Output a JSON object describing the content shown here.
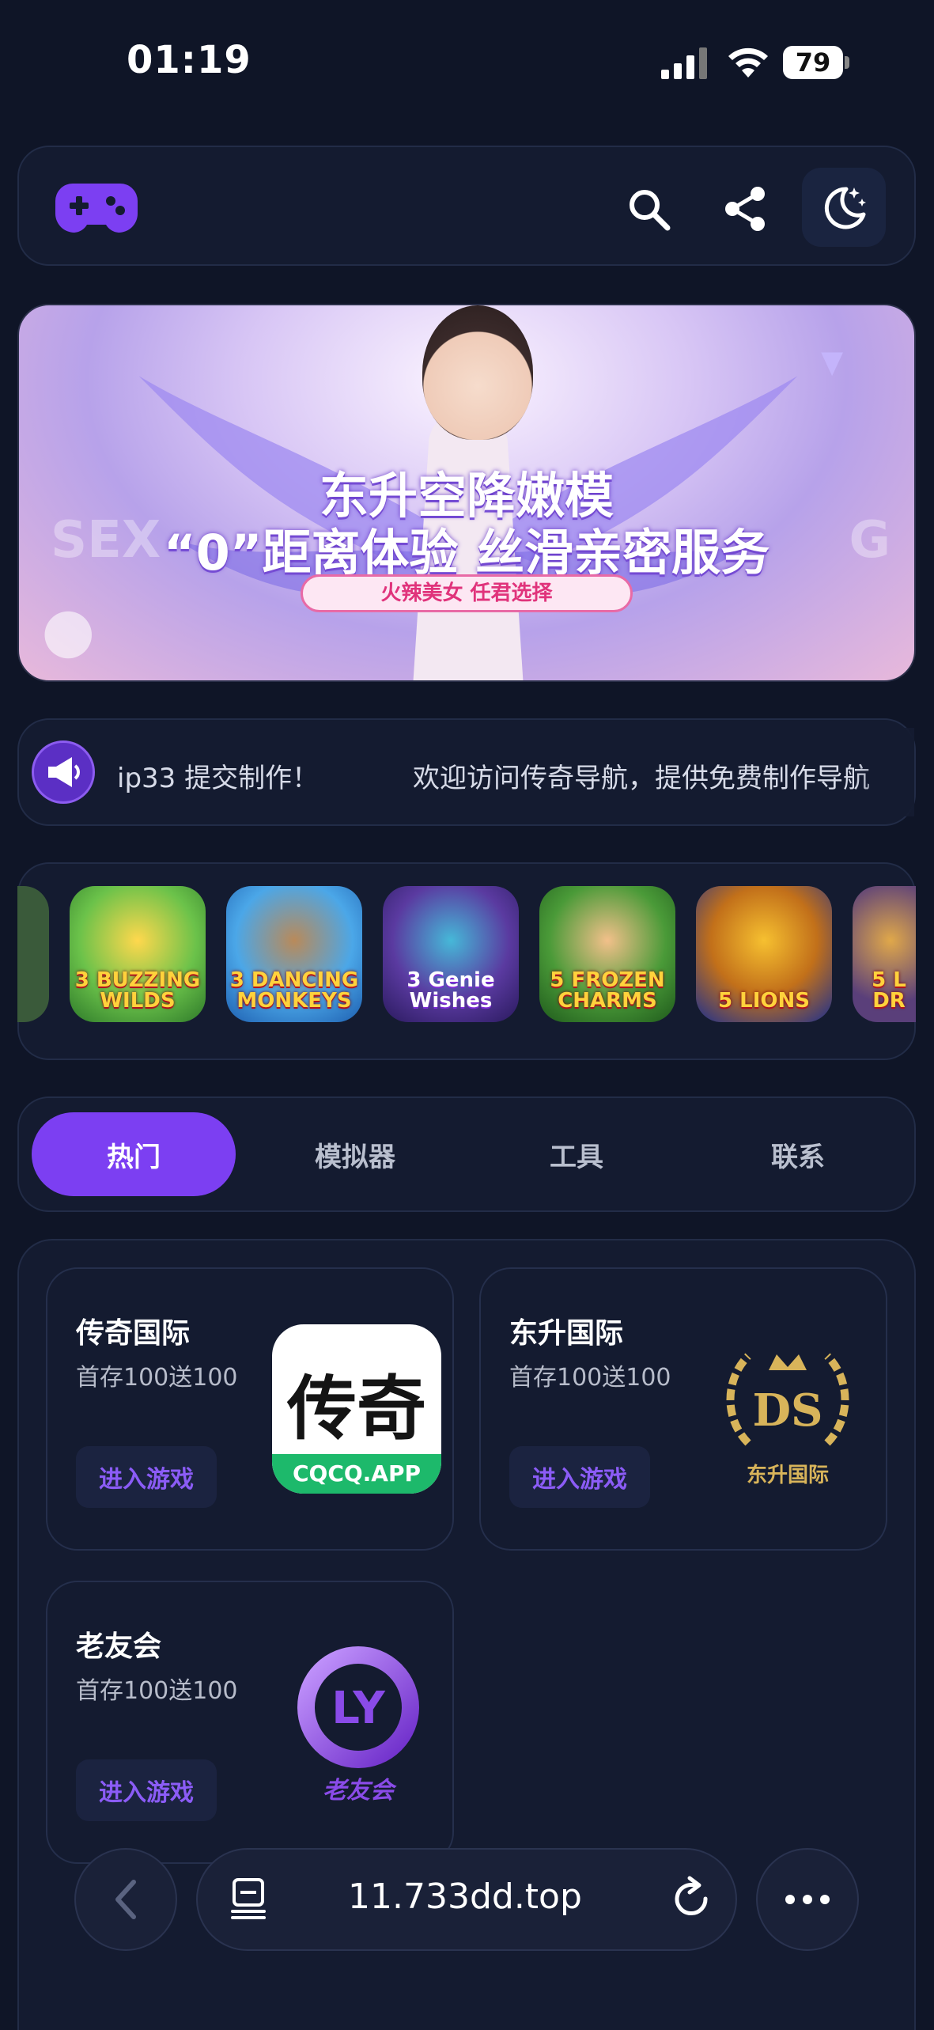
{
  "status_bar": {
    "time": "01:19",
    "battery": "79"
  },
  "banner": {
    "title_line1": "东升空降嫩模",
    "title_line2": "“0”距离体验 丝滑亲密服务",
    "pill": "火辣美女 任君选择",
    "left_watermark": "SEX",
    "right_watermark": "G"
  },
  "notice": {
    "segment1": "ip33 提交制作！",
    "segment2": "欢迎访问传奇导航，提供免费制作导航"
  },
  "game_icons": [
    {
      "label": "",
      "bg": "#3a5a3a"
    },
    {
      "label": "3 BUZZING WILDS",
      "bg": "#4bb04a"
    },
    {
      "label": "3 DANCING MONKEYS",
      "bg": "#2f8fd8"
    },
    {
      "label": "3 Genie Wishes",
      "bg": "#4d2b8a"
    },
    {
      "label": "5 FROZEN CHARMS",
      "bg": "#3f8a35"
    },
    {
      "label": "5 LIONS",
      "bg": "#1c2f8f"
    },
    {
      "label": "5 L DR",
      "bg": "#5a3f7a"
    }
  ],
  "tabs": [
    "热门",
    "模拟器",
    "工具",
    "联系"
  ],
  "active_tab": 0,
  "games": [
    {
      "name": "传奇国际",
      "promo": "首存100送100",
      "enter": "进入游戏",
      "logo_text": "传奇",
      "logo_sub": "CQCQ.APP"
    },
    {
      "name": "东升国际",
      "promo": "首存100送100",
      "enter": "进入游戏",
      "logo_text": "DS",
      "logo_sub": "东升国际"
    },
    {
      "name": "老友会",
      "promo": "首存100送100",
      "enter": "进入游戏",
      "logo_text": "LY",
      "logo_sub": "老友会"
    }
  ],
  "browser": {
    "url": "11.733dd.top"
  },
  "colors": {
    "accent": "#7c3ff2",
    "background": "#0f1527",
    "card": "#141b30"
  }
}
